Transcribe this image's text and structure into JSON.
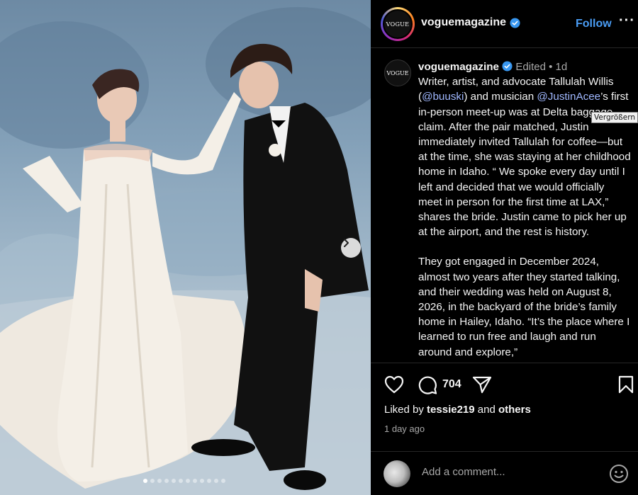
{
  "header": {
    "logo_text": "VOGUE",
    "username": "voguemagazine",
    "follow_label": "Follow",
    "more_label": "···"
  },
  "caption": {
    "username": "voguemagazine",
    "edited_meta": "Edited • 1d",
    "para1_a": "Writer, artist, and advocate Tallulah Willis (",
    "mention1": "@buuski",
    "para1_b": ") and musician ",
    "mention2": "@JustinAcee",
    "para1_c": "’s first in-person meet-up was at Delta baggage claim. After the pair matched, Justin immediately invited Tallulah for coffee—but at the time, she was staying at her childhood home in Idaho. “ We spoke every day until I left and decided that we would officially meet in person for the first time at LAX,” shares the bride. Justin came to pick her up at the airport, and the rest is history.",
    "para2": "They got engaged in December 2024, almost two years after they started talking, and their wedding was held on August 8, 2026, in the backyard of the bride’s family home in Hailey, Idaho. “It’s the place where I learned to run free and laugh and run around and explore,”"
  },
  "tooltip": "Vergrößern",
  "actions": {
    "like_icon": "heart-icon",
    "comment_icon": "comment-icon",
    "share_icon": "share-icon",
    "save_icon": "bookmark-icon",
    "comment_count": "704"
  },
  "likes": {
    "prefix": "Liked by ",
    "user": "tessie219",
    "middle": " and ",
    "others": "others"
  },
  "timestamp": "1 day ago",
  "add_comment": {
    "placeholder": "Add a comment..."
  },
  "carousel": {
    "total_slides": 12,
    "active_slide": 1
  },
  "colors": {
    "accent": "#4a9df5",
    "verified": "#3897f0",
    "background": "#000000"
  }
}
